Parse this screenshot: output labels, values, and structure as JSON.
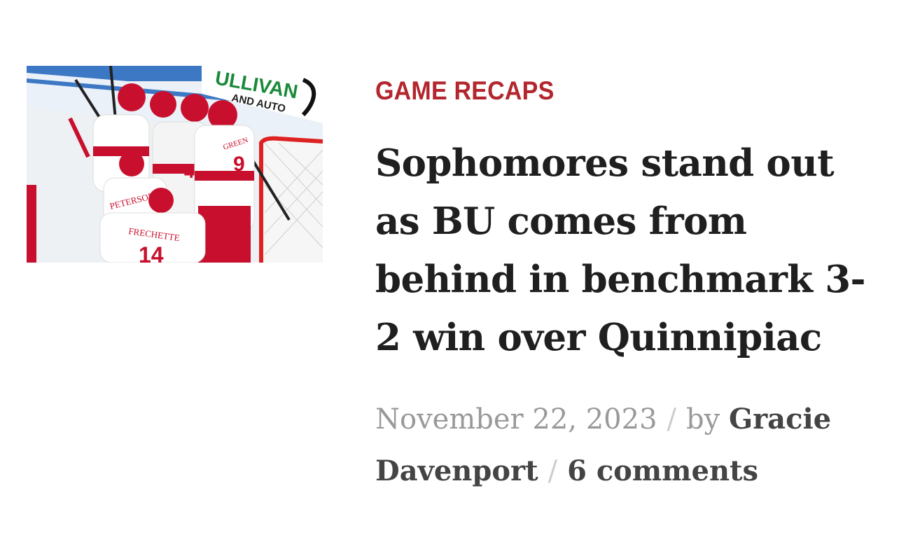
{
  "post": {
    "category": "GAME RECAPS",
    "title": "Sophomores stand out as BU comes from behind in benchmark 3-2 win over Quinnipiac",
    "date": "November 22, 2023",
    "separator": "/",
    "by_label": "by",
    "author": "Gracie Davenport",
    "comments": "6 comments"
  },
  "thumbnail": {
    "sign_line1": "ULLIVAN",
    "sign_line2": "AND AUTO",
    "jersey_names": [
      "PETERSON",
      "FRECHETTE",
      "GREEN"
    ],
    "jersey_numbers": [
      "14",
      "9",
      "4"
    ]
  },
  "colors": {
    "category": "#b3262e",
    "headline": "#1f1f1f",
    "meta": "#999999",
    "author": "#444444",
    "jersey_red": "#c8102e"
  }
}
